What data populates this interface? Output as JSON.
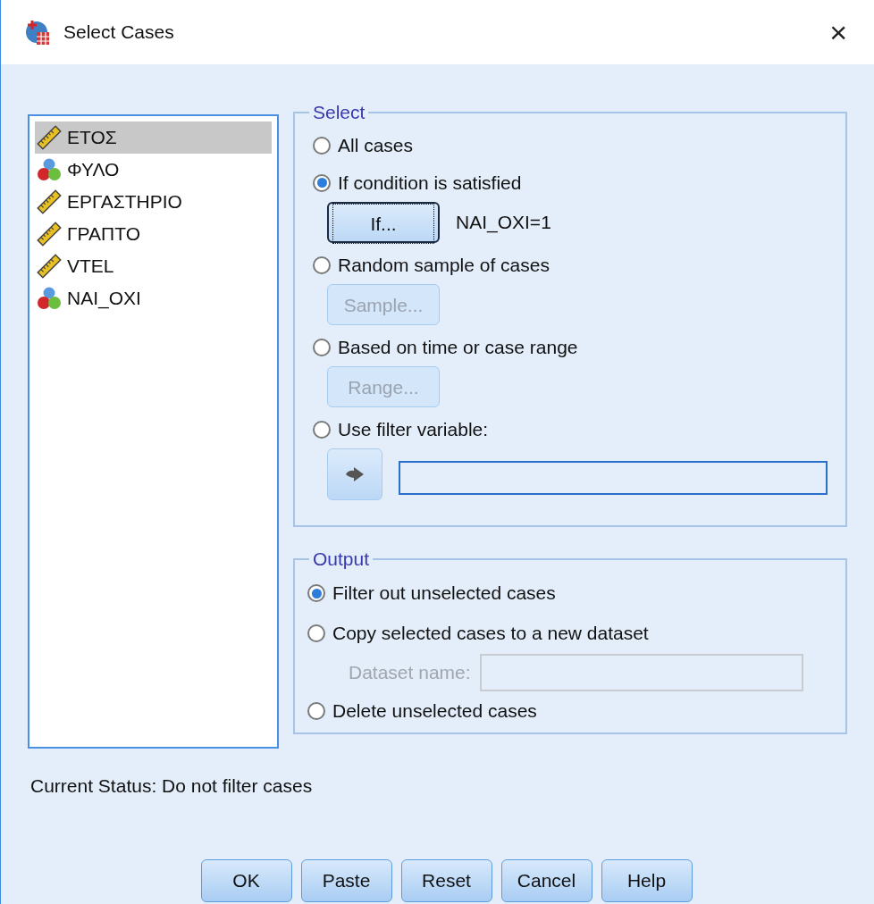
{
  "window": {
    "title": "Select Cases",
    "close": "×"
  },
  "variables": [
    {
      "name": "ΕΤΟΣ",
      "kind": "scale",
      "selected": true
    },
    {
      "name": "ΦΥΛΟ",
      "kind": "nominal",
      "selected": false
    },
    {
      "name": "ΕΡΓΑΣΤΗΡΙΟ",
      "kind": "scale",
      "selected": false
    },
    {
      "name": "ΓΡΑΠΤΟ",
      "kind": "scale",
      "selected": false
    },
    {
      "name": "VTEL",
      "kind": "scale",
      "selected": false
    },
    {
      "name": "NAI_OXI",
      "kind": "nominal",
      "selected": false
    }
  ],
  "select": {
    "legend": "Select",
    "options": [
      {
        "label": "All cases",
        "selected": false
      },
      {
        "label": "If condition is satisfied",
        "selected": true,
        "control": {
          "kind": "button",
          "label": "If...",
          "disabled": false,
          "focused": true,
          "note": "NAI_OXI=1"
        }
      },
      {
        "label": "Random sample of cases",
        "selected": false,
        "control": {
          "kind": "button",
          "label": "Sample...",
          "disabled": true,
          "focused": false
        }
      },
      {
        "label": "Based on time or case range",
        "selected": false,
        "control": {
          "kind": "button",
          "label": "Range...",
          "disabled": true,
          "focused": false
        }
      },
      {
        "label": "Use filter variable:",
        "selected": false,
        "control": {
          "kind": "variable_field"
        }
      }
    ]
  },
  "output": {
    "legend": "Output",
    "options": [
      {
        "label": "Filter out unselected cases",
        "selected": true
      },
      {
        "label": "Copy selected cases to a new dataset",
        "selected": false,
        "field": {
          "label": "Dataset name:",
          "disabled": true
        }
      },
      {
        "label": "Delete unselected cases",
        "selected": false
      }
    ]
  },
  "status": "Current Status: Do not filter cases",
  "buttons": [
    "OK",
    "Paste",
    "Reset",
    "Cancel",
    "Help"
  ]
}
